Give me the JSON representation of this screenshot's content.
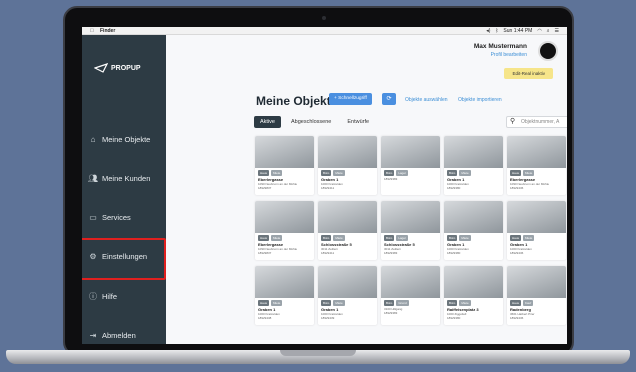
{
  "menubar": {
    "app": "Finder",
    "status": "Sun 1:44 PM"
  },
  "brand": {
    "logo_text": "PROPUP"
  },
  "sidebar": {
    "items": [
      {
        "label": "Meine Objekte",
        "icon": "home-icon"
      },
      {
        "label": "Meine Kunden",
        "icon": "users-icon"
      },
      {
        "label": "Services",
        "icon": "services-icon"
      },
      {
        "label": "Einstellungen",
        "icon": "gear-icon"
      },
      {
        "label": "Hilfe",
        "icon": "help-icon"
      },
      {
        "label": "Abmelden",
        "icon": "logout-icon"
      }
    ]
  },
  "user": {
    "name": "Max Mustermann",
    "edit": "Profil bearbeiten",
    "mode": "Edit-Real inaktiv"
  },
  "page": {
    "title": "Meine Objekte",
    "search_button": "+ Schnellzugriff",
    "link_select": "Objekte auswählen",
    "link_import": "Objekte importieren"
  },
  "tabs": [
    "Aktive",
    "Abgeschlossene",
    "Entwürfe"
  ],
  "search": {
    "placeholder": "Objektnummer, A"
  },
  "cards": [
    {
      "title": "Eberlergasse",
      "sub": "1090 Neubrunn an der Mühle",
      "id": "18929837",
      "c1": "Haus",
      "c2": "Miete"
    },
    {
      "title": "Graben 1",
      "sub": "1000 Kratzelden",
      "id": "18929411",
      "c1": "Büro",
      "c2": "Miete"
    },
    {
      "title": "",
      "sub": "",
      "id": "18929383",
      "c1": "Büro",
      "c2": "Lager"
    },
    {
      "title": "Graben 1",
      "sub": "1000 Kratzelden",
      "id": "18929380",
      "c1": "Büro",
      "c2": "Miete"
    },
    {
      "title": "Eberlergasse",
      "sub": "1090 Neubrunn an der Mühle",
      "id": "18929436",
      "c1": "Haus",
      "c2": "Miete"
    },
    {
      "title": "Eberlergasse",
      "sub": "1090 Neubrunn an der Mühle",
      "id": "18929837",
      "c1": "Haus",
      "c2": "Miete"
    },
    {
      "title": "Schlossstraße 5",
      "sub": "3011 Zeillern",
      "id": "18929411",
      "c1": "Büro",
      "c2": "Miete"
    },
    {
      "title": "Schlossstraße 5",
      "sub": "3011 Zeillern",
      "id": "18929383",
      "c1": "Büro",
      "c2": "Lager"
    },
    {
      "title": "Graben 1",
      "sub": "1000 Kratzelden",
      "id": "18929380",
      "c1": "Büro",
      "c2": "Miete"
    },
    {
      "title": "Graben 1",
      "sub": "1000 Kratzelden",
      "id": "18929436",
      "c1": "Haus",
      "c2": "Miete"
    },
    {
      "title": "Graben 1",
      "sub": "1000 Kratzelden",
      "id": "18929438",
      "c1": "Haus",
      "c2": "Miete"
    },
    {
      "title": "Graben 1",
      "sub": "1000 Kratzelden",
      "id": "18929439",
      "c1": "Büro",
      "c2": "Miete"
    },
    {
      "title": "",
      "sub": "3100 Hillgang",
      "id": "18929383",
      "c1": "Büro",
      "c2": "Grund"
    },
    {
      "title": "Raiffeisenplatz 3",
      "sub": "1000 Ziggoliell",
      "id": "18929380",
      "c1": "Büro",
      "c2": "Miete"
    },
    {
      "title": "Radenberg",
      "sub": "3661 Hatbert Pirer",
      "id": "18929436",
      "c1": "Haus",
      "c2": "Kauf"
    }
  ]
}
